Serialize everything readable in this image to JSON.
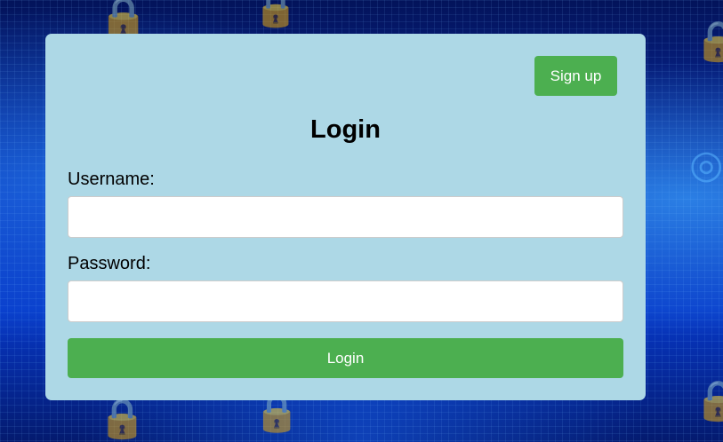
{
  "header": {
    "signup_label": "Sign up"
  },
  "form": {
    "title": "Login",
    "username_label": "Username:",
    "username_value": "",
    "password_label": "Password:",
    "password_value": "",
    "submit_label": "Login"
  },
  "colors": {
    "card_background": "#add8e6",
    "button_green": "#4caf50",
    "background_blue": "#0a2fb4"
  },
  "icons": {
    "background_decor": "padlock-icon"
  }
}
